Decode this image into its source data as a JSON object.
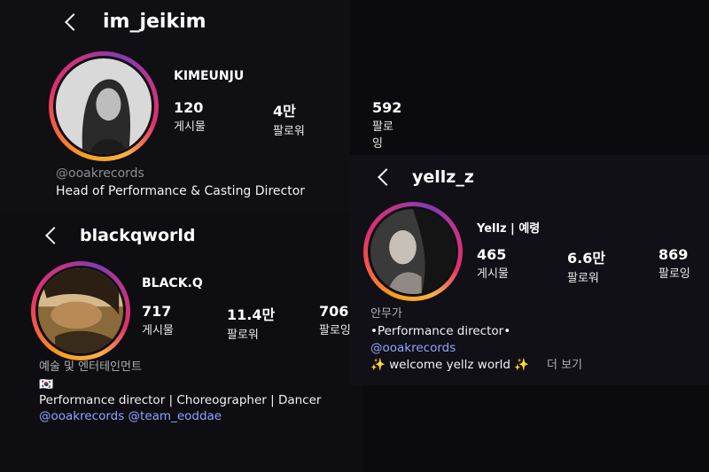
{
  "profiles": [
    {
      "username": "im_jeikim",
      "display_name": "KIMEUNJU",
      "stats": [
        {
          "value": "120",
          "label": "게시물"
        },
        {
          "value": "4만",
          "label": "팔로워"
        },
        {
          "value": "592",
          "label": "팔로잉"
        }
      ],
      "bio_link": "@ooakrecords",
      "bio_text": "Head of Performance & Casting Director"
    },
    {
      "username": "blackqworld",
      "display_name": "BLACK.Q",
      "stats": [
        {
          "value": "717",
          "label": "게시물"
        },
        {
          "value": "11.4만",
          "label": "팔로워"
        },
        {
          "value": "706",
          "label": "팔로잉"
        }
      ],
      "category": "예술 및 엔터테인먼트",
      "flag": "🇰🇷",
      "bio_text": "Performance director | Choreographer | Dancer",
      "bio_links": "@ooakrecords @team_eoddae"
    },
    {
      "username": "yellz_z",
      "display_name": "Yellz | 예령",
      "stats": [
        {
          "value": "465",
          "label": "게시물"
        },
        {
          "value": "6.6만",
          "label": "팔로워"
        },
        {
          "value": "869",
          "label": "팔로잉"
        }
      ],
      "category": "안무가",
      "bio_line1": "•Performance director•",
      "bio_link": "@ooakrecords",
      "bio_line3": "✨ welcome yellz world ✨",
      "more": "더 보기"
    }
  ],
  "icons": {
    "back": "chevron-left-icon",
    "avatar": "profile-photo"
  },
  "colors": {
    "background": "#0b0b0f",
    "link": "#92a3ff",
    "ring_start": "#f9a11b",
    "ring_end": "#c13584"
  }
}
